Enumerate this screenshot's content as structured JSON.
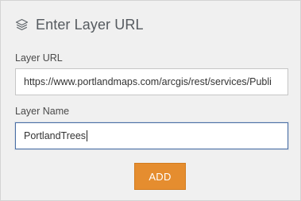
{
  "dialog": {
    "title": "Enter Layer URL",
    "icon": "layers-icon"
  },
  "form": {
    "url_label": "Layer URL",
    "url_value": "https://www.portlandmaps.com/arcgis/rest/services/Publi",
    "name_label": "Layer Name",
    "name_value": "PortlandTrees"
  },
  "actions": {
    "add_label": "ADD",
    "add_color": "#e58d2f"
  }
}
